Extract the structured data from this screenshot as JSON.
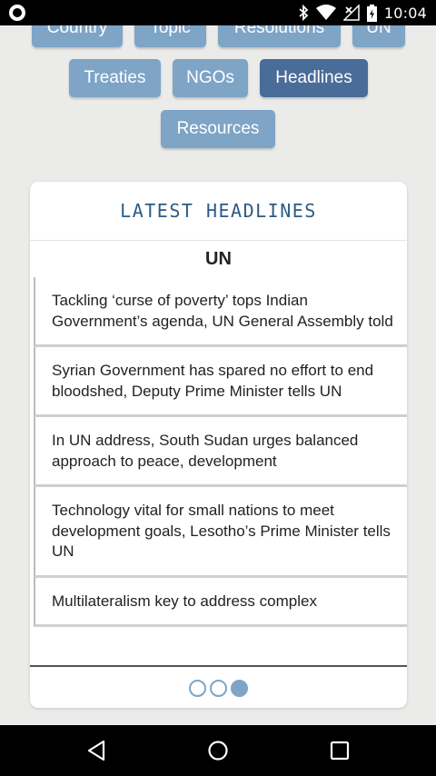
{
  "status_bar": {
    "time": "10:04",
    "icons": [
      "notification-ring-icon",
      "bluetooth-icon",
      "wifi-icon",
      "no-signal-icon",
      "battery-charging-icon"
    ]
  },
  "categories": [
    {
      "label": "Country",
      "active": false
    },
    {
      "label": "Topic",
      "active": false
    },
    {
      "label": "Resolutions",
      "active": false
    },
    {
      "label": "UN",
      "active": false
    },
    {
      "label": "Treaties",
      "active": false
    },
    {
      "label": "NGOs",
      "active": false
    },
    {
      "label": "Headlines",
      "active": true
    },
    {
      "label": "Resources",
      "active": false
    }
  ],
  "card": {
    "title": "LATEST HEADLINES",
    "subtitle": "UN",
    "headlines": [
      "Tackling ‘curse of poverty’ tops Indian Government’s agenda, UN General Assembly told",
      "Syrian Government has spared no effort to end bloodshed, Deputy Prime Minister tells UN",
      "In UN address, South Sudan urges balanced approach to peace, development",
      "Technology vital for small nations to meet development goals, Lesotho’s Prime Minister tells UN",
      "Multilateralism key to address complex"
    ],
    "pager": {
      "pages": 3,
      "active_page": 3
    }
  },
  "nav_bar": {
    "icons": [
      "back-icon",
      "home-icon",
      "recents-icon"
    ]
  },
  "colors": {
    "button": "#7ea4c6",
    "button_active": "#4a6c98",
    "title": "#2d5b85",
    "background": "#ebebea"
  }
}
